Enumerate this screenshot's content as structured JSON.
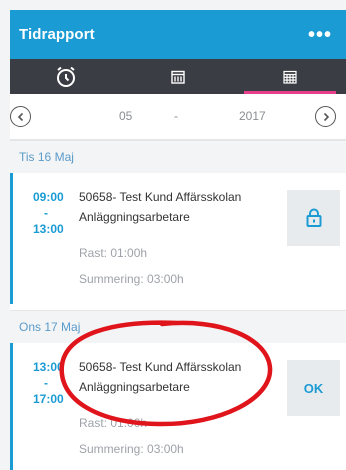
{
  "header": {
    "title": "Tidrapport",
    "more_label": "•••"
  },
  "tabs": [
    {
      "icon": "alarm-clock-icon",
      "active": false
    },
    {
      "icon": "calendar-week-icon",
      "active": false
    },
    {
      "icon": "calendar-month-icon",
      "active": true
    }
  ],
  "period": {
    "month": "05",
    "separator": "-",
    "year": "2017",
    "prev_icon": "chevron-left-icon",
    "next_icon": "chevron-right-icon"
  },
  "days": [
    {
      "label": "Tis 16 Maj",
      "entry": {
        "start": "09:00",
        "dash": "-",
        "end": "13:00",
        "project": "50658- Test Kund Affärsskolan",
        "role": "Anläggningsarbetare",
        "break": "Rast: 01:00h",
        "summary": "Summering: 03:00h",
        "status_icon": "lock-icon",
        "status_label": ""
      }
    },
    {
      "label": "Ons 17 Maj",
      "entry": {
        "start": "13:00",
        "dash": "-",
        "end": "17:00",
        "project": "50658- Test Kund Affärsskolan",
        "role": "Anläggningsarbetare",
        "break": "Rast: 01:00h",
        "summary": "Summering: 03:00h",
        "status_icon": "",
        "status_label": "OK"
      }
    }
  ],
  "colors": {
    "accent": "#1a9bd3",
    "tab_bar": "#3a3d43",
    "active_tab_underline": "#e83e8c",
    "annotation": "#e0141b"
  }
}
